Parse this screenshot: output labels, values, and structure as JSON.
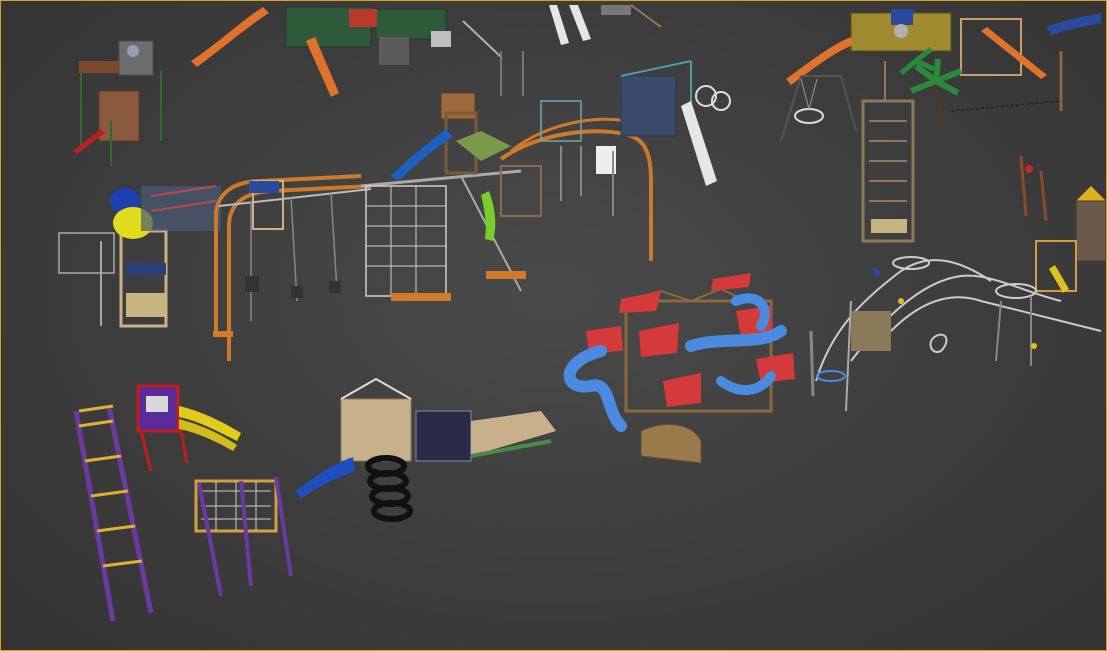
{
  "viewport": {
    "label": "",
    "border_color": "#d9a21a",
    "background_color": "#3f3f3f"
  },
  "scene": {
    "objects": [
      "tower-slide-set-top-left",
      "orange-slide-play-structure-top",
      "twin-white-slides-top",
      "pirate-ship-play-structure-top-right",
      "palm-tree-swings-top-right",
      "ladder-tower-right",
      "tube-tower-left",
      "arched-monkey-bar-rope-course",
      "wooden-tree-house-blue-slide",
      "climbing-wall-white-slide",
      "rope-swing-tower-far-right",
      "castle-tower-far-right",
      "purple-climbing-ladder",
      "purple-mini-slide",
      "rope-net-climber",
      "tire-stack-rope-bridge",
      "red-roof-tube-slide-complex",
      "rope-dome-climbing-course"
    ]
  }
}
